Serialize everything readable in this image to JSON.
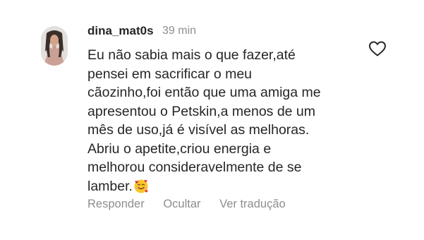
{
  "comment": {
    "username": "dina_mat0s",
    "time": "39 min",
    "text_lines": [
      "Eu não sabia mais o que fazer,até",
      "pensei em sacrificar o meu",
      "cãozinho,foi então que uma amiga me",
      "apresentou o Petskin,a menos de um",
      "mês de uso,já é visível as melhoras.",
      "Abriu o apetite,criou energia e",
      "melhorou consideravelmente de se",
      "lamber."
    ],
    "emoji": "smiling-face-with-hearts",
    "like_icon": "heart-outline-icon",
    "actions": {
      "reply": "Responder",
      "hide": "Ocultar",
      "see_translation": "Ver tradução"
    }
  },
  "colors": {
    "primary_text": "#262626",
    "secondary_text": "#8e8e8e",
    "background": "#ffffff"
  }
}
